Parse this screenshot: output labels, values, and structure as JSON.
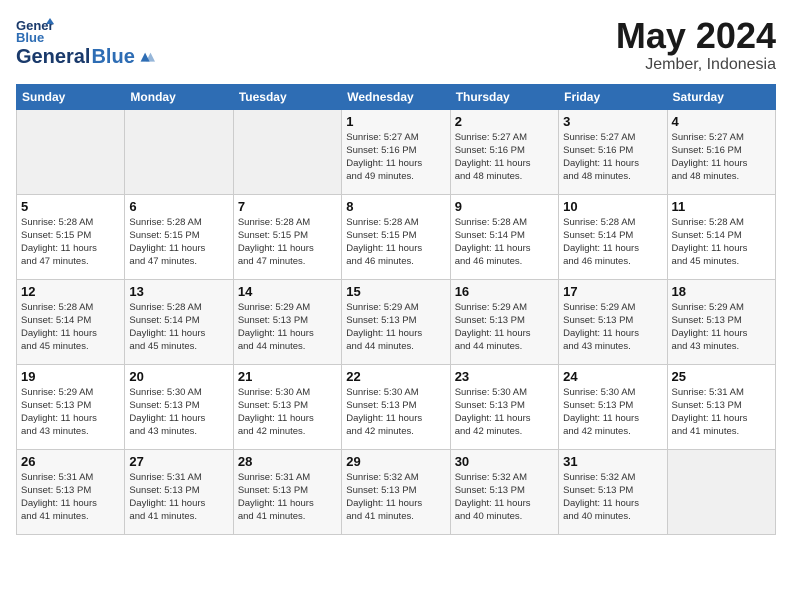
{
  "header": {
    "logo_general": "General",
    "logo_blue": "Blue",
    "month": "May 2024",
    "location": "Jember, Indonesia"
  },
  "weekdays": [
    "Sunday",
    "Monday",
    "Tuesday",
    "Wednesday",
    "Thursday",
    "Friday",
    "Saturday"
  ],
  "weeks": [
    [
      {
        "day": "",
        "info": ""
      },
      {
        "day": "",
        "info": ""
      },
      {
        "day": "",
        "info": ""
      },
      {
        "day": "1",
        "info": "Sunrise: 5:27 AM\nSunset: 5:16 PM\nDaylight: 11 hours\nand 49 minutes."
      },
      {
        "day": "2",
        "info": "Sunrise: 5:27 AM\nSunset: 5:16 PM\nDaylight: 11 hours\nand 48 minutes."
      },
      {
        "day": "3",
        "info": "Sunrise: 5:27 AM\nSunset: 5:16 PM\nDaylight: 11 hours\nand 48 minutes."
      },
      {
        "day": "4",
        "info": "Sunrise: 5:27 AM\nSunset: 5:16 PM\nDaylight: 11 hours\nand 48 minutes."
      }
    ],
    [
      {
        "day": "5",
        "info": "Sunrise: 5:28 AM\nSunset: 5:15 PM\nDaylight: 11 hours\nand 47 minutes."
      },
      {
        "day": "6",
        "info": "Sunrise: 5:28 AM\nSunset: 5:15 PM\nDaylight: 11 hours\nand 47 minutes."
      },
      {
        "day": "7",
        "info": "Sunrise: 5:28 AM\nSunset: 5:15 PM\nDaylight: 11 hours\nand 47 minutes."
      },
      {
        "day": "8",
        "info": "Sunrise: 5:28 AM\nSunset: 5:15 PM\nDaylight: 11 hours\nand 46 minutes."
      },
      {
        "day": "9",
        "info": "Sunrise: 5:28 AM\nSunset: 5:14 PM\nDaylight: 11 hours\nand 46 minutes."
      },
      {
        "day": "10",
        "info": "Sunrise: 5:28 AM\nSunset: 5:14 PM\nDaylight: 11 hours\nand 46 minutes."
      },
      {
        "day": "11",
        "info": "Sunrise: 5:28 AM\nSunset: 5:14 PM\nDaylight: 11 hours\nand 45 minutes."
      }
    ],
    [
      {
        "day": "12",
        "info": "Sunrise: 5:28 AM\nSunset: 5:14 PM\nDaylight: 11 hours\nand 45 minutes."
      },
      {
        "day": "13",
        "info": "Sunrise: 5:28 AM\nSunset: 5:14 PM\nDaylight: 11 hours\nand 45 minutes."
      },
      {
        "day": "14",
        "info": "Sunrise: 5:29 AM\nSunset: 5:13 PM\nDaylight: 11 hours\nand 44 minutes."
      },
      {
        "day": "15",
        "info": "Sunrise: 5:29 AM\nSunset: 5:13 PM\nDaylight: 11 hours\nand 44 minutes."
      },
      {
        "day": "16",
        "info": "Sunrise: 5:29 AM\nSunset: 5:13 PM\nDaylight: 11 hours\nand 44 minutes."
      },
      {
        "day": "17",
        "info": "Sunrise: 5:29 AM\nSunset: 5:13 PM\nDaylight: 11 hours\nand 43 minutes."
      },
      {
        "day": "18",
        "info": "Sunrise: 5:29 AM\nSunset: 5:13 PM\nDaylight: 11 hours\nand 43 minutes."
      }
    ],
    [
      {
        "day": "19",
        "info": "Sunrise: 5:29 AM\nSunset: 5:13 PM\nDaylight: 11 hours\nand 43 minutes."
      },
      {
        "day": "20",
        "info": "Sunrise: 5:30 AM\nSunset: 5:13 PM\nDaylight: 11 hours\nand 43 minutes."
      },
      {
        "day": "21",
        "info": "Sunrise: 5:30 AM\nSunset: 5:13 PM\nDaylight: 11 hours\nand 42 minutes."
      },
      {
        "day": "22",
        "info": "Sunrise: 5:30 AM\nSunset: 5:13 PM\nDaylight: 11 hours\nand 42 minutes."
      },
      {
        "day": "23",
        "info": "Sunrise: 5:30 AM\nSunset: 5:13 PM\nDaylight: 11 hours\nand 42 minutes."
      },
      {
        "day": "24",
        "info": "Sunrise: 5:30 AM\nSunset: 5:13 PM\nDaylight: 11 hours\nand 42 minutes."
      },
      {
        "day": "25",
        "info": "Sunrise: 5:31 AM\nSunset: 5:13 PM\nDaylight: 11 hours\nand 41 minutes."
      }
    ],
    [
      {
        "day": "26",
        "info": "Sunrise: 5:31 AM\nSunset: 5:13 PM\nDaylight: 11 hours\nand 41 minutes."
      },
      {
        "day": "27",
        "info": "Sunrise: 5:31 AM\nSunset: 5:13 PM\nDaylight: 11 hours\nand 41 minutes."
      },
      {
        "day": "28",
        "info": "Sunrise: 5:31 AM\nSunset: 5:13 PM\nDaylight: 11 hours\nand 41 minutes."
      },
      {
        "day": "29",
        "info": "Sunrise: 5:32 AM\nSunset: 5:13 PM\nDaylight: 11 hours\nand 41 minutes."
      },
      {
        "day": "30",
        "info": "Sunrise: 5:32 AM\nSunset: 5:13 PM\nDaylight: 11 hours\nand 40 minutes."
      },
      {
        "day": "31",
        "info": "Sunrise: 5:32 AM\nSunset: 5:13 PM\nDaylight: 11 hours\nand 40 minutes."
      },
      {
        "day": "",
        "info": ""
      }
    ]
  ]
}
